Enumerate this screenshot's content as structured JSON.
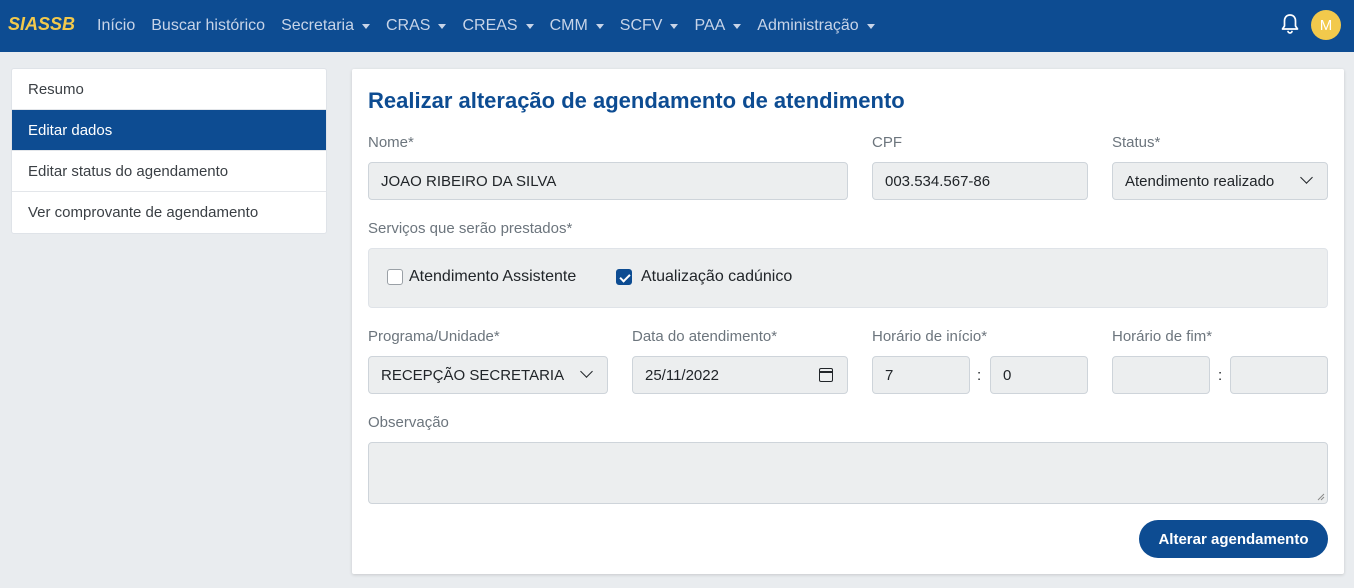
{
  "app": {
    "brand": "SIASSB",
    "user_initial": "M"
  },
  "nav": {
    "items": [
      {
        "label": "Início",
        "dropdown": false
      },
      {
        "label": "Buscar histórico",
        "dropdown": false
      },
      {
        "label": "Secretaria",
        "dropdown": true
      },
      {
        "label": "CRAS",
        "dropdown": true
      },
      {
        "label": "CREAS",
        "dropdown": true
      },
      {
        "label": "CMM",
        "dropdown": true
      },
      {
        "label": "SCFV",
        "dropdown": true
      },
      {
        "label": "PAA",
        "dropdown": true
      },
      {
        "label": "Administração",
        "dropdown": true
      }
    ]
  },
  "sidebar": {
    "items": [
      {
        "label": "Resumo",
        "active": false
      },
      {
        "label": "Editar dados",
        "active": true
      },
      {
        "label": "Editar status do agendamento",
        "active": false
      },
      {
        "label": "Ver comprovante de agendamento",
        "active": false
      }
    ]
  },
  "form": {
    "title": "Realizar alteração de agendamento de atendimento",
    "nome_label": "Nome*",
    "nome_value": "JOAO RIBEIRO DA SILVA",
    "cpf_label": "CPF",
    "cpf_value": "003.534.567-86",
    "status_label": "Status*",
    "status_value": "Atendimento realizado",
    "servicos_label": "Serviços que serão prestados*",
    "servicos": [
      {
        "label": "Atendimento Assistente",
        "checked": false
      },
      {
        "label": "Atualização cadúnico",
        "checked": true
      }
    ],
    "programa_label": "Programa/Unidade*",
    "programa_value": "RECEPÇÃO SECRETARIA",
    "data_label": "Data do atendimento*",
    "data_value": "25/11/2022",
    "inicio_label": "Horário de início*",
    "inicio_hora": "7",
    "inicio_min": "0",
    "fim_label": "Horário de fim*",
    "fim_hora": "",
    "fim_min": "",
    "separator": ":",
    "observacao_label": "Observação",
    "observacao_value": "",
    "submit_label": "Alterar agendamento"
  },
  "colors": {
    "primary": "#0d4c92",
    "brand": "#f2c94c",
    "background": "#e9ecef"
  },
  "icons": {
    "notifications": "bell-icon",
    "calendar": "calendar-icon",
    "select": "chevron-down-icon"
  }
}
